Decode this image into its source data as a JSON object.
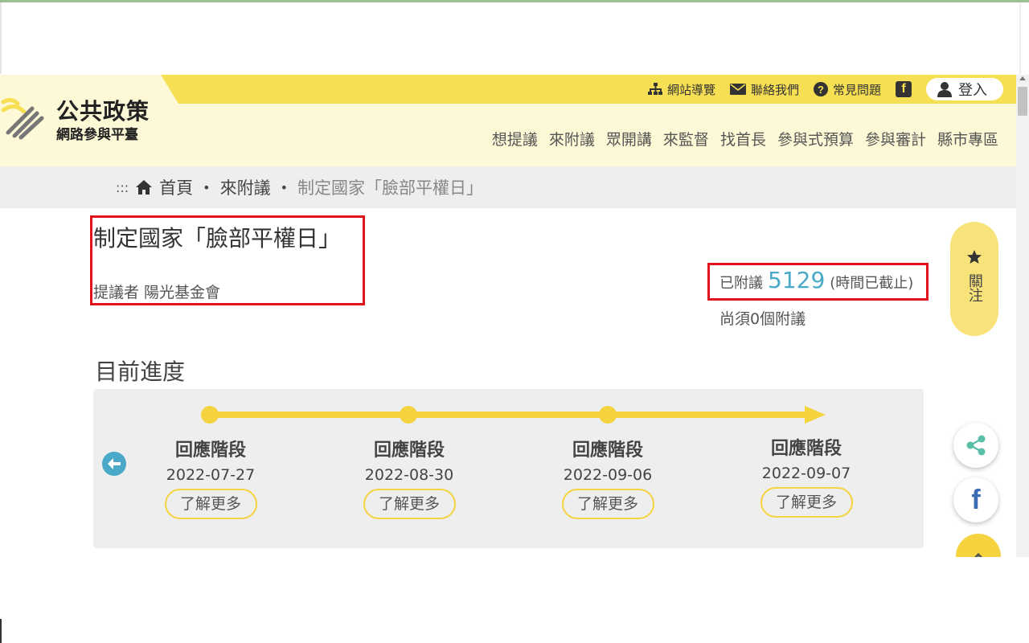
{
  "header": {
    "logo_title": "公共政策",
    "logo_sub": "網路參與平臺",
    "util": [
      {
        "label": "網站導覽",
        "icon": "sitemap-icon"
      },
      {
        "label": "聯絡我們",
        "icon": "envelope-icon"
      },
      {
        "label": "常見問題",
        "icon": "question-icon"
      }
    ],
    "facebook_icon_glyph": "f",
    "login_label": "登入",
    "nav": [
      "想提議",
      "來附議",
      "眾開講",
      "來監督",
      "找首長",
      "參與式預算",
      "參與審計",
      "縣市專區"
    ]
  },
  "breadcrumb": {
    "dots": ":::",
    "home": "首頁",
    "section": "來附議",
    "current": "制定國家「臉部平權日」"
  },
  "proposal": {
    "title": "制定國家「臉部平權日」",
    "proposer": "提議者 陽光基金會",
    "count_label": "已附議",
    "count_value": "5129",
    "count_status": "(時間已截止)",
    "needed": "尚須0個附議"
  },
  "follow": {
    "label": "關注"
  },
  "progress": {
    "heading": "目前進度",
    "stages": [
      {
        "name": "回應階段",
        "date": "2022-07-27",
        "more": "了解更多"
      },
      {
        "name": "回應階段",
        "date": "2022-08-30",
        "more": "了解更多"
      },
      {
        "name": "回應階段",
        "date": "2022-09-06",
        "more": "了解更多"
      },
      {
        "name": "回應階段",
        "date": "2022-09-07",
        "more": "了解更多"
      }
    ]
  },
  "social": {
    "facebook_glyph": "f"
  },
  "colors": {
    "header_bg": "#fdf8d6",
    "accent_yellow": "#f7df53",
    "count_blue": "#4aa9c8",
    "highlight_red": "#e1141e"
  }
}
